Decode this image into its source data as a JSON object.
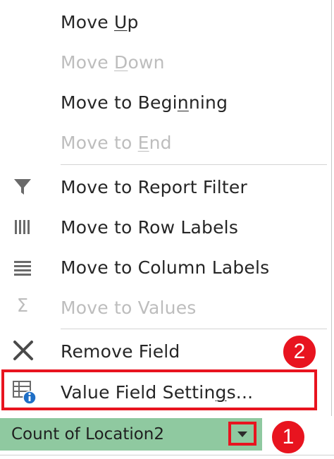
{
  "menu": {
    "move_up": "Move Up",
    "move_down": "Move Down",
    "move_to_beginning": "Move to Beginning",
    "move_to_end": "Move to End",
    "move_to_report_filter": "Move to Report Filter",
    "move_to_row_labels": "Move to Row Labels",
    "move_to_column_labels": "Move to Column Labels",
    "move_to_values": "Move to Values",
    "remove_field": "Remove Field",
    "value_field_settings": "Value Field Settings..."
  },
  "field": {
    "name": "Count of Location2"
  },
  "annotations": {
    "step1": "1",
    "step2": "2"
  },
  "colors": {
    "highlight": "#e8141f",
    "field_bar": "#8fc9a0",
    "info_icon": "#1f6fc6"
  },
  "icons": [
    "filter-icon",
    "row-labels-icon",
    "column-labels-icon",
    "sigma-icon",
    "remove-x-icon",
    "field-settings-icon",
    "dropdown-arrow-icon"
  ]
}
